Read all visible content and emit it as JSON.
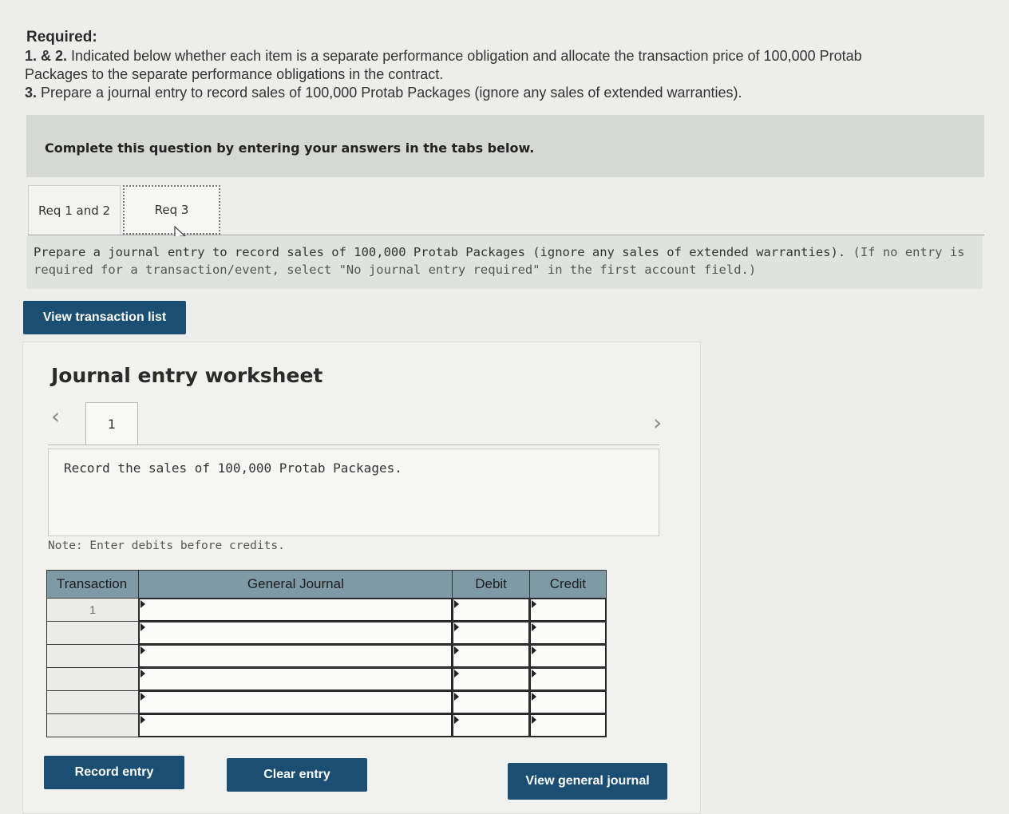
{
  "required": {
    "title": "Required:",
    "line1_num": "1. & 2.",
    "line1_text": " Indicated below whether each item is a separate performance obligation and allocate the transaction price of 100,000 Protab",
    "line2_text": "Packages to the separate performance obligations in the contract.",
    "line3_num": "3.",
    "line3_text": " Prepare a journal entry to record sales of 100,000 Protab Packages (ignore any sales of extended warranties)."
  },
  "complete_banner": "Complete this question by entering your answers in the tabs below.",
  "tabs": [
    {
      "label": "Req 1 and 2"
    },
    {
      "label": "Req 3"
    }
  ],
  "instructions": {
    "main": "Prepare a journal entry to record sales of 100,000 Protab Packages (ignore any sales of extended warranties).",
    "paren": "(If no entry is required for a transaction/event, select \"No journal entry required\" in the first account field.)"
  },
  "buttons": {
    "view_transaction_list": "View transaction list",
    "record_entry": "Record entry",
    "clear_entry": "Clear entry",
    "view_general_journal": "View general journal"
  },
  "worksheet": {
    "title": "Journal entry worksheet",
    "entry_tab": "1",
    "prev_icon": "chevron-left-icon",
    "next_icon": "chevron-right-icon",
    "description": "Record the sales of 100,000 Protab Packages.",
    "note": "Note: Enter debits before credits."
  },
  "journal_table": {
    "headers": [
      "Transaction",
      "General Journal",
      "Debit",
      "Credit"
    ],
    "rows": [
      {
        "transaction": "1",
        "account": "",
        "debit": "",
        "credit": ""
      },
      {
        "transaction": "",
        "account": "",
        "debit": "",
        "credit": ""
      },
      {
        "transaction": "",
        "account": "",
        "debit": "",
        "credit": ""
      },
      {
        "transaction": "",
        "account": "",
        "debit": "",
        "credit": ""
      },
      {
        "transaction": "",
        "account": "",
        "debit": "",
        "credit": ""
      },
      {
        "transaction": "",
        "account": "",
        "debit": "",
        "credit": ""
      }
    ]
  },
  "colors": {
    "button_bg": "#1a4f73",
    "table_header": "#7e9aa6"
  }
}
